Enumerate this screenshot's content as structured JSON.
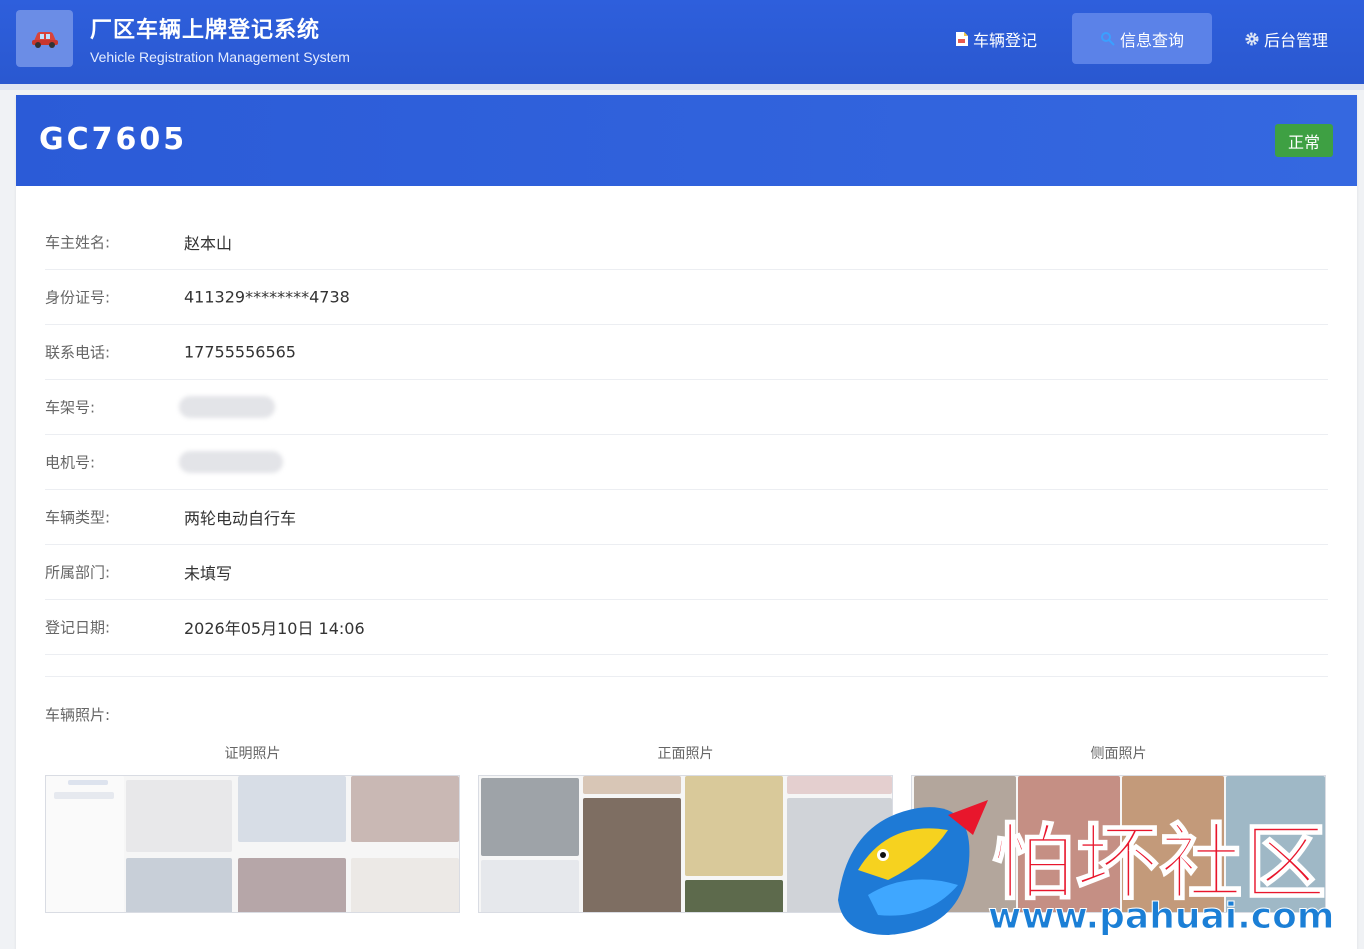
{
  "app": {
    "title": "厂区车辆上牌登记系统",
    "subtitle": "Vehicle Registration Management System",
    "logo_icon": "car-icon"
  },
  "nav": {
    "items": [
      {
        "label": "车辆登记",
        "icon": "document-icon",
        "active": false
      },
      {
        "label": "信息查询",
        "icon": "search-icon",
        "active": true
      },
      {
        "label": "后台管理",
        "icon": "gear-icon",
        "active": false
      }
    ]
  },
  "vehicle": {
    "plate": "GC7605",
    "status": "正常",
    "status_color": "#3ea043",
    "fields": [
      {
        "label": "车主姓名:",
        "value": "赵本山"
      },
      {
        "label": "身份证号:",
        "value": "411329********4738"
      },
      {
        "label": "联系电话:",
        "value": "17755556565"
      },
      {
        "label": "车架号:",
        "value": ""
      },
      {
        "label": "电机号:",
        "value": ""
      },
      {
        "label": "车辆类型:",
        "value": "两轮电动自行车"
      },
      {
        "label": "所属部门:",
        "value": "未填写"
      },
      {
        "label": "登记日期:",
        "value": "2026年05月10日 14:06"
      }
    ]
  },
  "photos": {
    "label": "车辆照片:",
    "items": [
      {
        "caption": "证明照片"
      },
      {
        "caption": "正面照片"
      },
      {
        "caption": "侧面照片"
      }
    ]
  },
  "watermark": {
    "text": "怕坏社区",
    "url": "www.pahuai.com"
  },
  "colors": {
    "primary": "#2b5ad6",
    "active_nav": "#5b82e8",
    "brand_red": "#e8162c",
    "brand_blue": "#1b7fd6"
  }
}
